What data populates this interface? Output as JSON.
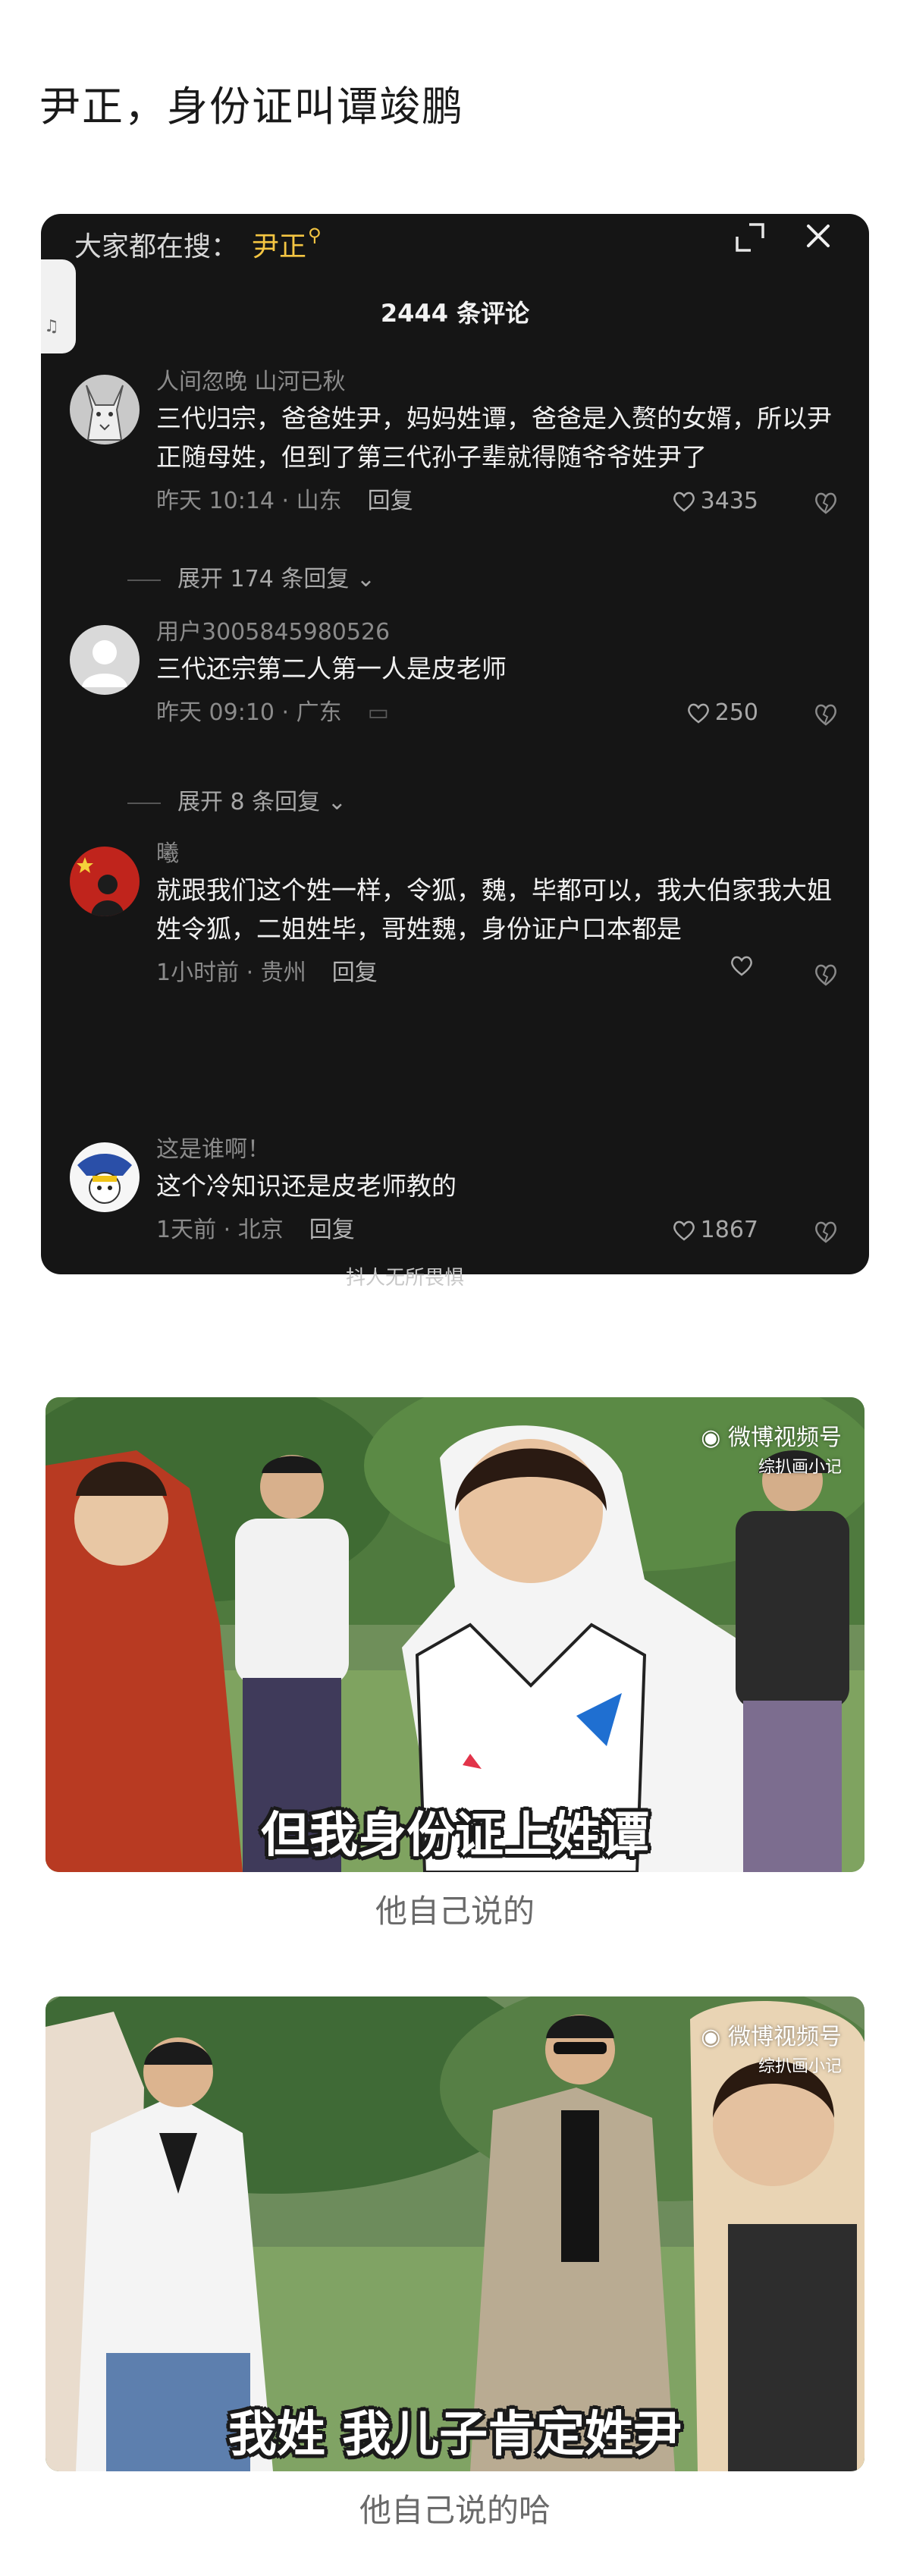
{
  "post": {
    "title": "尹正，身份证叫谭竣鹏"
  },
  "screenshot": {
    "search_hint": "大家都在搜：",
    "search_keyword": "尹正",
    "comment_count_title": "2444 条评论",
    "comments": [
      {
        "user": "人间忽晚 山河已秋",
        "text": "三代归宗，爸爸姓尹，妈妈姓谭，爸爸是入赘的女婿，所以尹正随母姓，但到了第三代孙子辈就得随爷爷姓尹了",
        "meta": "昨天 10:14 · 山东",
        "reply_label": "回复",
        "likes": "3435",
        "expand_label": "展开 174 条回复"
      },
      {
        "user": "用户3005845980526",
        "text": "三代还宗第二人第一人是皮老师",
        "meta": "昨天 09:10 · 广东",
        "reply_label": "",
        "likes": "250",
        "expand_label": "展开 8 条回复"
      },
      {
        "user": "曦",
        "text": "就跟我们这个姓一样，令狐，魏，毕都可以，我大伯家我大姐姓令狐，二姐姓毕，哥姓魏，身份证户口本都是",
        "meta": "1小时前 · 贵州",
        "reply_label": "回复",
        "likes": ""
      },
      {
        "user": "这是谁啊！",
        "text": "这个冷知识还是皮老师教的",
        "meta": "1天前 · 北京",
        "reply_label": "回复",
        "likes": "1867"
      }
    ],
    "watermark": "抖人无所畏惧"
  },
  "frames": [
    {
      "subtitle": "但我身份证上姓谭",
      "logo": "微博视频号",
      "logo_sub": "综扒画小记",
      "caption": "他自己说的"
    },
    {
      "subtitle": "我姓 我儿子肯定姓尹",
      "logo": "微博视频号",
      "logo_sub": "综扒画小记",
      "caption": "他自己说的哈"
    }
  ],
  "colors": {
    "panel": "#151515",
    "keyword": "#f4c542",
    "caption": "#6a6a6a"
  }
}
